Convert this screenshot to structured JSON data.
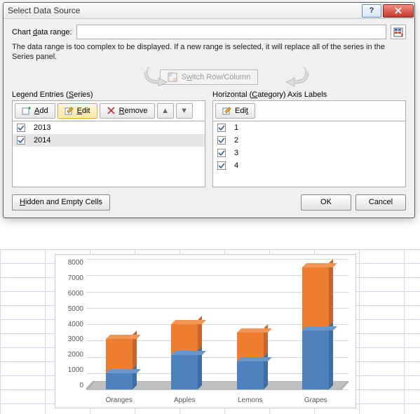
{
  "dialog": {
    "title": "Select Data Source",
    "range_label_pre": "Chart ",
    "range_label_u": "d",
    "range_label_post": "ata range:",
    "range_value": "",
    "warning": "The data range is too complex to be displayed. If a new range is selected, it will replace all of the series in the Series panel.",
    "switch_label": "Switch Row/Column",
    "left": {
      "header_pre": "Legend Entries (",
      "header_u": "S",
      "header_post": "eries)",
      "add": "Add",
      "edit": "Edit",
      "remove": "Remove",
      "items": [
        "2013",
        "2014"
      ]
    },
    "right": {
      "header_pre": "Horizontal (",
      "header_u": "C",
      "header_post": "ategory) Axis Labels",
      "edit": "Edit",
      "items": [
        "1",
        "2",
        "3",
        "4"
      ]
    },
    "hidden_btn": "Hidden and Empty Cells",
    "ok": "OK",
    "cancel": "Cancel"
  },
  "chart_data": {
    "type": "bar",
    "stacked": true,
    "categories": [
      "Oranges",
      "Apples",
      "Lemons",
      "Grapes"
    ],
    "series": [
      {
        "name": "2013",
        "values": [
          1000,
          2100,
          1700,
          3600
        ]
      },
      {
        "name": "2014",
        "values": [
          2100,
          1900,
          1800,
          3900
        ]
      }
    ],
    "ylim": [
      0,
      8000
    ],
    "ytick": 1000,
    "xlabel": "",
    "ylabel": ""
  }
}
